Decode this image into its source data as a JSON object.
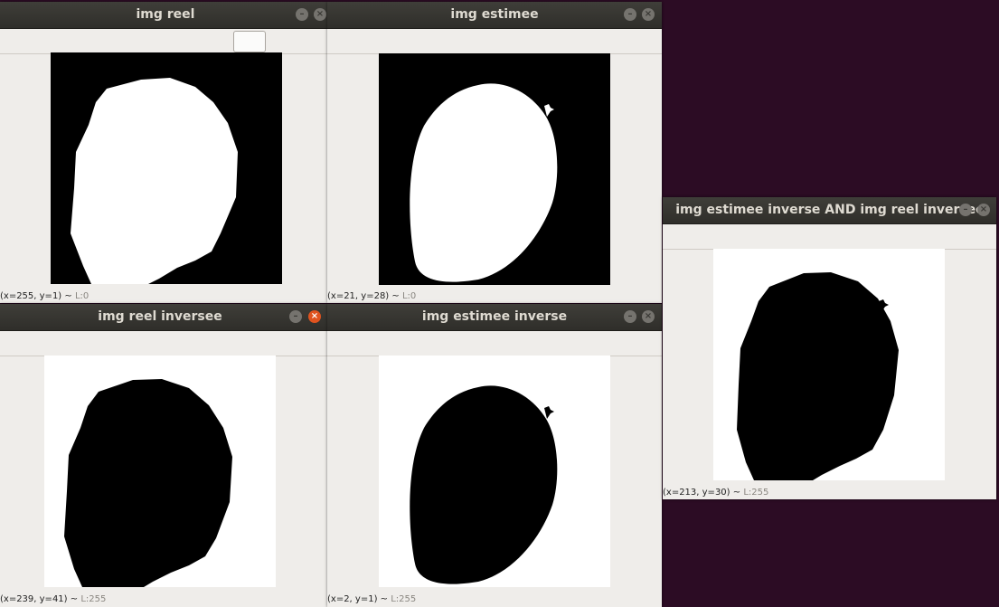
{
  "colors": {
    "desktop": "#2c0c24",
    "titlebar": "#3a3935",
    "window_bg": "#efedea",
    "close_active": "#e0531f"
  },
  "windows": {
    "reel": {
      "title": "img reel",
      "status_coords": "(x=255, y=1) ~",
      "status_value": "L:0"
    },
    "estimee": {
      "title": "img estimee",
      "status_coords": "(x=21, y=28) ~",
      "status_value": "L:0"
    },
    "reel_inversee": {
      "title": "img reel inversee",
      "status_coords": "(x=239, y=41) ~",
      "status_value": "L:255"
    },
    "estimee_inverse": {
      "title": "img estimee inverse",
      "status_coords": "(x=2, y=1) ~",
      "status_value": "L:255"
    },
    "and_window": {
      "title": "img estimee inverse AND img reel inversee",
      "status_coords": "(x=213, y=30) ~",
      "status_value": "L:255"
    }
  },
  "icons": {
    "minimize": "minimize-icon",
    "close": "close-icon"
  }
}
